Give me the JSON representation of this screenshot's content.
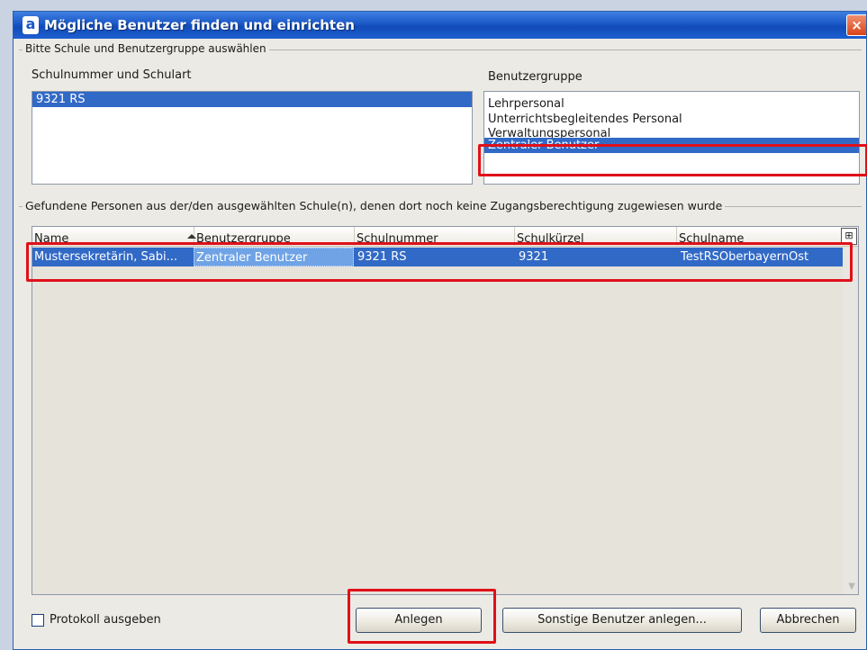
{
  "window": {
    "title": "Mögliche Benutzer finden und einrichten",
    "app_icon_glyph": "a",
    "close_glyph": "×"
  },
  "group1": {
    "legend": "Bitte Schule und Benutzergruppe auswählen",
    "school_label": "Schulnummer und Schulart",
    "schools": [
      {
        "label": "9321 RS",
        "selected": true
      }
    ],
    "usergroup_label": "Benutzergruppe",
    "usergroups": [
      {
        "label": "Lehrpersonal",
        "selected": false
      },
      {
        "label": "Unterrichtsbegleitendes Personal",
        "selected": false
      },
      {
        "label": "Verwaltungspersonal",
        "selected": false
      },
      {
        "label": "Zentraler Benutzer",
        "selected": true
      }
    ]
  },
  "group2": {
    "legend": "Gefundene Personen aus der/den ausgewählten Schule(n), denen dort noch keine Zugangsberechtigung zugewiesen wurde",
    "columns": [
      "Name",
      "Benutzergruppe",
      "Schulnummer",
      "Schulkürzel",
      "Schulname"
    ],
    "column_chooser_glyph": "⊞",
    "rows": [
      {
        "name": "Mustersekretärin, Sabi...",
        "benutzergruppe": "Zentraler Benutzer",
        "schulnummer": "9321 RS",
        "schulkuerzel": "9321",
        "schulname": "TestRSOberbayernOst"
      }
    ]
  },
  "footer": {
    "protokoll_label": "Protokoll ausgeben",
    "protokoll_checked": false,
    "anlegen_label": "Anlegen",
    "sonstige_label": "Sonstige Benutzer anlegen...",
    "abbrechen_label": "Abbrechen"
  },
  "colors": {
    "selection": "#3169c6",
    "highlight_box": "#e0101a",
    "titlebar": "#1a58c8"
  }
}
